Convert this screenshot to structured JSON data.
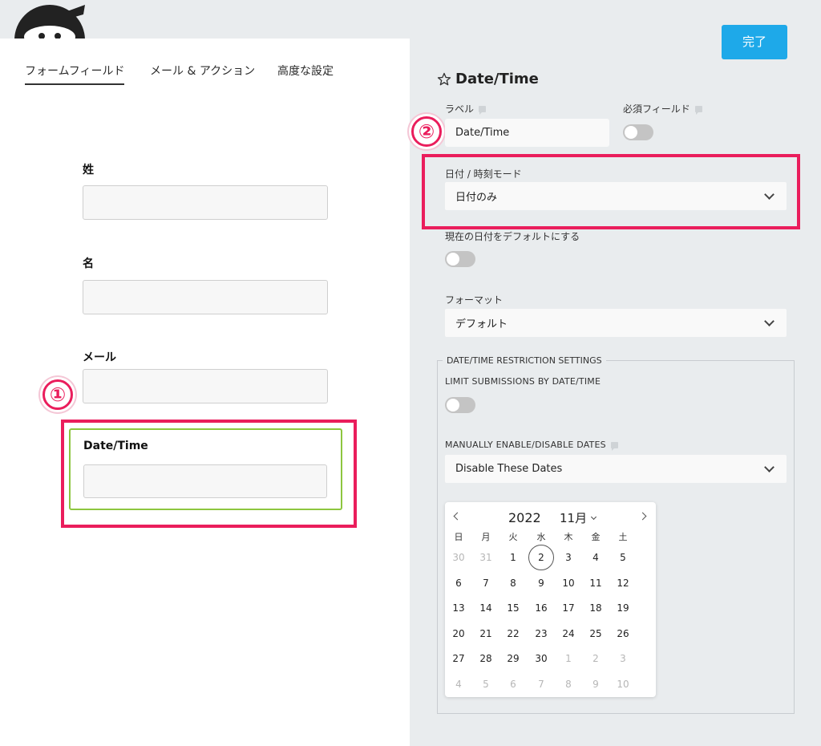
{
  "header": {
    "done_label": "完了"
  },
  "tabs": [
    "フォームフィールド",
    "メール & アクション",
    "高度な設定"
  ],
  "form_fields": [
    {
      "label": "姓"
    },
    {
      "label": "名"
    },
    {
      "label": "メール"
    },
    {
      "label": "Date/Time"
    }
  ],
  "markers": {
    "one": "①",
    "two": "②"
  },
  "settings": {
    "title": "Date/Time",
    "label_caption": "ラベル",
    "label_value": "Date/Time",
    "required_caption": "必須フィールド",
    "mode_caption": "日付 / 時刻モード",
    "mode_value": "日付のみ",
    "default_today_caption": "現在の日付をデフォルトにする",
    "format_caption": "フォーマット",
    "format_value": "デフォルト",
    "restriction_legend": "DATE/TIME RESTRICTION SETTINGS",
    "limit_caption": "LIMIT SUBMISSIONS BY DATE/TIME",
    "manual_caption": "MANUALLY ENABLE/DISABLE DATES",
    "manual_value": "Disable These Dates"
  },
  "calendar": {
    "year": "2022",
    "month": "11月",
    "weekdays": [
      "日",
      "月",
      "火",
      "水",
      "木",
      "金",
      "土"
    ],
    "weeks": [
      [
        {
          "d": "30",
          "m": true
        },
        {
          "d": "31",
          "m": true
        },
        {
          "d": "1"
        },
        {
          "d": "2",
          "today": true
        },
        {
          "d": "3"
        },
        {
          "d": "4"
        },
        {
          "d": "5"
        }
      ],
      [
        {
          "d": "6"
        },
        {
          "d": "7"
        },
        {
          "d": "8"
        },
        {
          "d": "9"
        },
        {
          "d": "10"
        },
        {
          "d": "11"
        },
        {
          "d": "12"
        }
      ],
      [
        {
          "d": "13"
        },
        {
          "d": "14"
        },
        {
          "d": "15"
        },
        {
          "d": "16"
        },
        {
          "d": "17"
        },
        {
          "d": "18"
        },
        {
          "d": "19"
        }
      ],
      [
        {
          "d": "20"
        },
        {
          "d": "21"
        },
        {
          "d": "22"
        },
        {
          "d": "23"
        },
        {
          "d": "24"
        },
        {
          "d": "25"
        },
        {
          "d": "26"
        }
      ],
      [
        {
          "d": "27"
        },
        {
          "d": "28"
        },
        {
          "d": "29"
        },
        {
          "d": "30"
        },
        {
          "d": "1",
          "m": true
        },
        {
          "d": "2",
          "m": true
        },
        {
          "d": "3",
          "m": true
        }
      ],
      [
        {
          "d": "4",
          "m": true
        },
        {
          "d": "5",
          "m": true
        },
        {
          "d": "6",
          "m": true
        },
        {
          "d": "7",
          "m": true
        },
        {
          "d": "8",
          "m": true
        },
        {
          "d": "9",
          "m": true
        },
        {
          "d": "10",
          "m": true
        }
      ]
    ]
  },
  "colors": {
    "accent": "#1ea9e9",
    "highlight": "#ea1d5c",
    "selected_field": "#8dc63f"
  }
}
